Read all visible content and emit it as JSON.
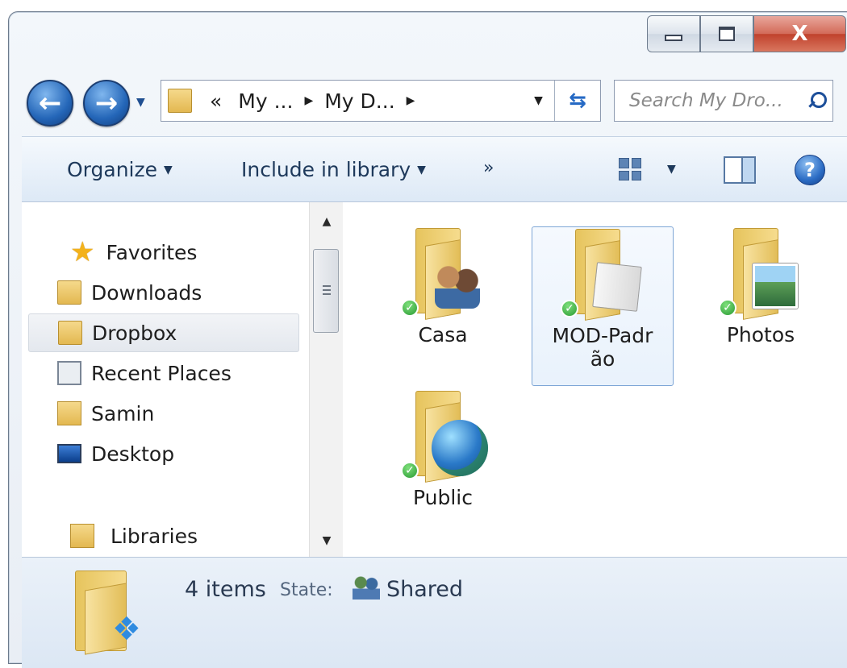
{
  "window": {
    "close_label": "X"
  },
  "address": {
    "overflow": "«",
    "crumbs": [
      "My ...",
      "My D..."
    ]
  },
  "search": {
    "placeholder": "Search My Dro..."
  },
  "toolbar": {
    "organize": "Organize",
    "include_in_library": "Include in library",
    "more": "»"
  },
  "navigation": {
    "favorites": "Favorites",
    "items": [
      {
        "label": "Downloads",
        "icon": "downloads-folder-icon"
      },
      {
        "label": "Dropbox",
        "icon": "dropbox-folder-icon",
        "selected": true
      },
      {
        "label": "Recent Places",
        "icon": "recent-places-icon"
      },
      {
        "label": "Samin",
        "icon": "user-folder-icon"
      },
      {
        "label": "Desktop",
        "icon": "desktop-icon"
      }
    ],
    "libraries": "Libraries"
  },
  "files": [
    {
      "name": "Casa",
      "overlay": "people",
      "synced": true
    },
    {
      "name_line1": "MOD-Padr",
      "name_line2": "ão",
      "overlay": "documents",
      "synced": true,
      "selected": true
    },
    {
      "name": "Photos",
      "overlay": "photo",
      "synced": true
    },
    {
      "name": "Public",
      "overlay": "globe",
      "synced": true
    }
  ],
  "details": {
    "count": "4 items",
    "state_label": "State:",
    "state_value": "Shared"
  },
  "colors": {
    "accent": "#2466b8",
    "sync_green": "#2a9a34",
    "close_red": "#c0412c"
  }
}
